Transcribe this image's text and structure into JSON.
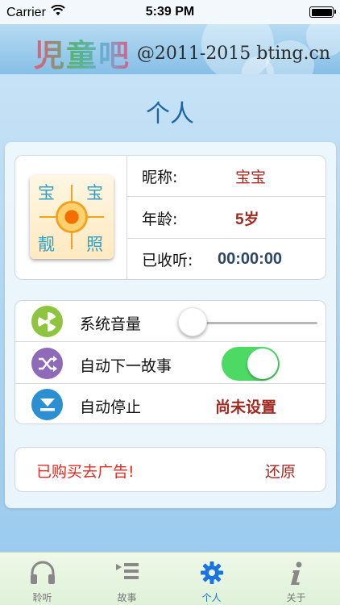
{
  "status_bar": {
    "carrier": "Carrier",
    "time": "5:39 PM"
  },
  "banner": {
    "logo": "児童吧",
    "url": "@2011-2015 bting.cn"
  },
  "page_title": "个人",
  "profile": {
    "avatar_chars": [
      "宝",
      "宝",
      "靓",
      "照"
    ],
    "rows": [
      {
        "label": "昵称:",
        "value": "宝宝"
      },
      {
        "label": "年龄:",
        "value": "5岁"
      },
      {
        "label": "已收听:",
        "value": "00:00:00"
      }
    ]
  },
  "settings": {
    "volume_label": "系统音量",
    "volume_level": 0.0,
    "autonext_label": "自动下一故事",
    "autonext_on": true,
    "autostop_label": "自动停止",
    "autostop_value": "尚未设置"
  },
  "ad": {
    "status": "已购买去广告!",
    "restore": "还原"
  },
  "tabs": [
    {
      "label": "聆听",
      "icon": "headphones-icon"
    },
    {
      "label": "故事",
      "icon": "story-list-icon"
    },
    {
      "label": "个人",
      "icon": "gear-icon",
      "active": true
    },
    {
      "label": "关于",
      "icon": "info-icon"
    }
  ],
  "colors": {
    "accent": "#1a74e0",
    "value_red": "#a02a22",
    "toggle_green": "#4cd964",
    "ad_red": "#e02b22"
  }
}
